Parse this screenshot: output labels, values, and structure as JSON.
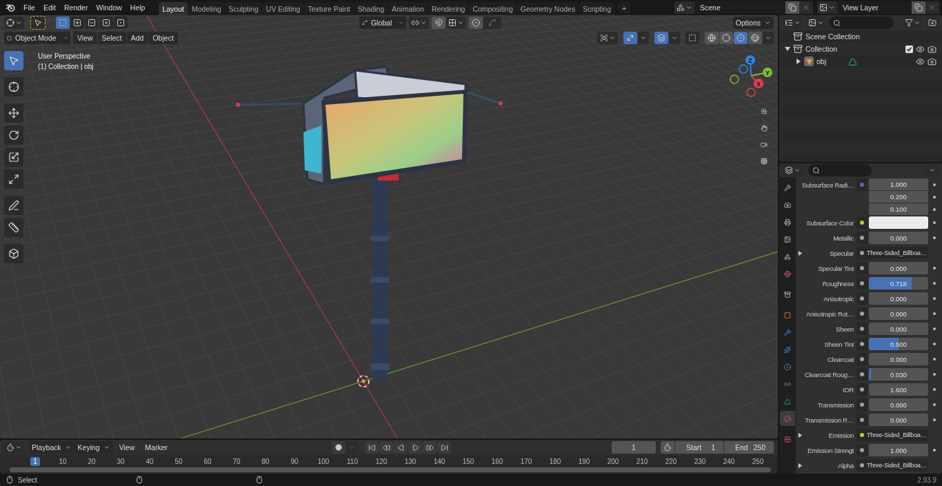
{
  "menu": [
    "File",
    "Edit",
    "Render",
    "Window",
    "Help"
  ],
  "workspaces": [
    {
      "label": "Layout",
      "selected": true
    },
    {
      "label": "Modeling",
      "selected": false
    },
    {
      "label": "Sculpting",
      "selected": false
    },
    {
      "label": "UV Editing",
      "selected": false
    },
    {
      "label": "Texture Paint",
      "selected": false
    },
    {
      "label": "Shading",
      "selected": false
    },
    {
      "label": "Animation",
      "selected": false
    },
    {
      "label": "Rendering",
      "selected": false
    },
    {
      "label": "Compositing",
      "selected": false
    },
    {
      "label": "Geometry Nodes",
      "selected": false
    },
    {
      "label": "Scripting",
      "selected": false
    }
  ],
  "add_workspace": "+",
  "scene": {
    "value": "Scene"
  },
  "view_layer": {
    "value": "View Layer"
  },
  "viewport": {
    "select_modes": [
      {
        "kind": "set",
        "selected": true
      },
      {
        "kind": "extend",
        "selected": false
      },
      {
        "kind": "subtract",
        "selected": false
      },
      {
        "kind": "difference",
        "selected": false
      },
      {
        "kind": "intersect",
        "selected": false
      }
    ],
    "transform_orientation": "Global",
    "options": "Options",
    "mode": "Object Mode",
    "menu": [
      "View",
      "Select",
      "Add",
      "Object"
    ],
    "toggles": [
      {
        "kind": "gizmos",
        "on": true
      },
      {
        "kind": "overlays",
        "on": true
      },
      {
        "kind": "xray",
        "on": false
      }
    ],
    "shading": [
      {
        "kind": "wireframe",
        "selected": false
      },
      {
        "kind": "solid",
        "selected": false
      },
      {
        "kind": "material",
        "selected": true
      },
      {
        "kind": "rendered",
        "selected": false
      }
    ],
    "view_name": "User Perspective",
    "context": "(1) Collection | obj",
    "tools": [
      {
        "kind": "select",
        "selected": true
      },
      {
        "kind": "cursor",
        "selected": false
      },
      {
        "kind": "move",
        "selected": false
      },
      {
        "kind": "rotate",
        "selected": false
      },
      {
        "kind": "scale",
        "selected": false
      },
      {
        "kind": "transform",
        "selected": false
      },
      {
        "kind": "annotate",
        "selected": false
      },
      {
        "kind": "measure",
        "selected": false
      },
      {
        "kind": "add_cube",
        "selected": false
      }
    ],
    "gizmo_axes": [
      {
        "label": "Z",
        "color": "#2f83e6"
      },
      {
        "label": "Y",
        "color": "#7fb83a"
      },
      {
        "label": "X",
        "color": "#e0404f"
      }
    ]
  },
  "outliner": {
    "root": "Scene Collection",
    "items": [
      {
        "kind": "collection",
        "label": "Collection",
        "expanded": true,
        "checked": true,
        "children": [
          {
            "kind": "object",
            "label": "obj",
            "expanded": false
          }
        ]
      }
    ]
  },
  "properties": {
    "tabs": [
      {
        "kind": "tool",
        "selected": false
      },
      {
        "kind": "render",
        "selected": false
      },
      {
        "kind": "output",
        "selected": false
      },
      {
        "kind": "view_layer",
        "selected": false
      },
      {
        "kind": "scene",
        "selected": false
      },
      {
        "kind": "world",
        "selected": false
      },
      {
        "kind": "collection",
        "selected": false
      },
      {
        "kind": "object",
        "selected": false
      },
      {
        "kind": "modifiers",
        "selected": false
      },
      {
        "kind": "particles",
        "selected": false
      },
      {
        "kind": "physics",
        "selected": false
      },
      {
        "kind": "constraints",
        "selected": false
      },
      {
        "kind": "data",
        "selected": false
      },
      {
        "kind": "material",
        "selected": true
      },
      {
        "kind": "texture",
        "selected": false
      }
    ],
    "rows": [
      {
        "kind": "vector",
        "label": "Subsurface Radi…",
        "color": "#6363c7",
        "values": [
          "1.000",
          "0.200",
          "0.100"
        ]
      },
      {
        "kind": "color",
        "label": "Subsurface Color",
        "color": "#c7c729",
        "swatch": {
          "color": "#ebebeb"
        }
      },
      {
        "kind": "slider",
        "label": "Metallic",
        "color": "#a1a1a1",
        "value": "0.000",
        "level": 0
      },
      {
        "kind": "link",
        "label": "Specular",
        "color": "#a1a1a1",
        "value": "Three-Sided_Billboa…",
        "expanded": false
      },
      {
        "kind": "slider",
        "label": "Specular Tint",
        "color": "#a1a1a1",
        "value": "0.000",
        "level": 0
      },
      {
        "kind": "slider",
        "label": "Roughness",
        "color": "#a1a1a1",
        "value": "0.718",
        "level": 0.718
      },
      {
        "kind": "slider",
        "label": "Anisotropic",
        "color": "#a1a1a1",
        "value": "0.000",
        "level": 0
      },
      {
        "kind": "slider",
        "label": "Anisotropic Rot…",
        "color": "#a1a1a1",
        "value": "0.000",
        "level": 0
      },
      {
        "kind": "slider",
        "label": "Sheen",
        "color": "#a1a1a1",
        "value": "0.000",
        "level": 0
      },
      {
        "kind": "slider",
        "label": "Sheen Tint",
        "color": "#a1a1a1",
        "value": "0.500",
        "level": 0.5
      },
      {
        "kind": "slider",
        "label": "Clearcoat",
        "color": "#a1a1a1",
        "value": "0.000",
        "level": 0
      },
      {
        "kind": "slider",
        "label": "Clearcoat Roug…",
        "color": "#a1a1a1",
        "value": "0.030",
        "level": 0.03
      },
      {
        "kind": "number",
        "label": "IOR",
        "color": "#a1a1a1",
        "value": "1.600"
      },
      {
        "kind": "slider",
        "label": "Transmission",
        "color": "#a1a1a1",
        "value": "0.000",
        "level": 0
      },
      {
        "kind": "slider",
        "label": "Transmission R…",
        "color": "#a1a1a1",
        "value": "0.000",
        "level": 0
      },
      {
        "kind": "link",
        "label": "Emission",
        "color": "#c7c729",
        "value": "Three-Sided_Billboa…",
        "expanded": false
      },
      {
        "kind": "number",
        "label": "Emission Strengt",
        "color": "#a1a1a1",
        "value": "1.000"
      },
      {
        "kind": "link",
        "label": "Alpha",
        "color": "#a1a1a1",
        "value": "Three-Sided_Billboa…",
        "expanded": false
      }
    ]
  },
  "timeline": {
    "menu": [
      "Playback",
      "Keying",
      "View",
      "Marker"
    ],
    "current_frame": "1",
    "start_label": "Start",
    "start": "1",
    "end_label": "End",
    "end": "250",
    "ruler": [
      {
        "label": "1",
        "selected": true
      },
      {
        "label": "10",
        "selected": false
      },
      {
        "label": "20",
        "selected": false
      },
      {
        "label": "30",
        "selected": false
      },
      {
        "label": "40",
        "selected": false
      },
      {
        "label": "50",
        "selected": false
      },
      {
        "label": "60",
        "selected": false
      },
      {
        "label": "70",
        "selected": false
      },
      {
        "label": "80",
        "selected": false
      },
      {
        "label": "90",
        "selected": false
      },
      {
        "label": "100",
        "selected": false
      },
      {
        "label": "110",
        "selected": false
      },
      {
        "label": "120",
        "selected": false
      },
      {
        "label": "130",
        "selected": false
      },
      {
        "label": "140",
        "selected": false
      },
      {
        "label": "150",
        "selected": false
      },
      {
        "label": "160",
        "selected": false
      },
      {
        "label": "170",
        "selected": false
      },
      {
        "label": "180",
        "selected": false
      },
      {
        "label": "190",
        "selected": false
      },
      {
        "label": "200",
        "selected": false
      },
      {
        "label": "210",
        "selected": false
      },
      {
        "label": "220",
        "selected": false
      },
      {
        "label": "230",
        "selected": false
      },
      {
        "label": "240",
        "selected": false
      },
      {
        "label": "250",
        "selected": false
      }
    ]
  },
  "status": {
    "action": "Select",
    "version": "2.93.9"
  }
}
